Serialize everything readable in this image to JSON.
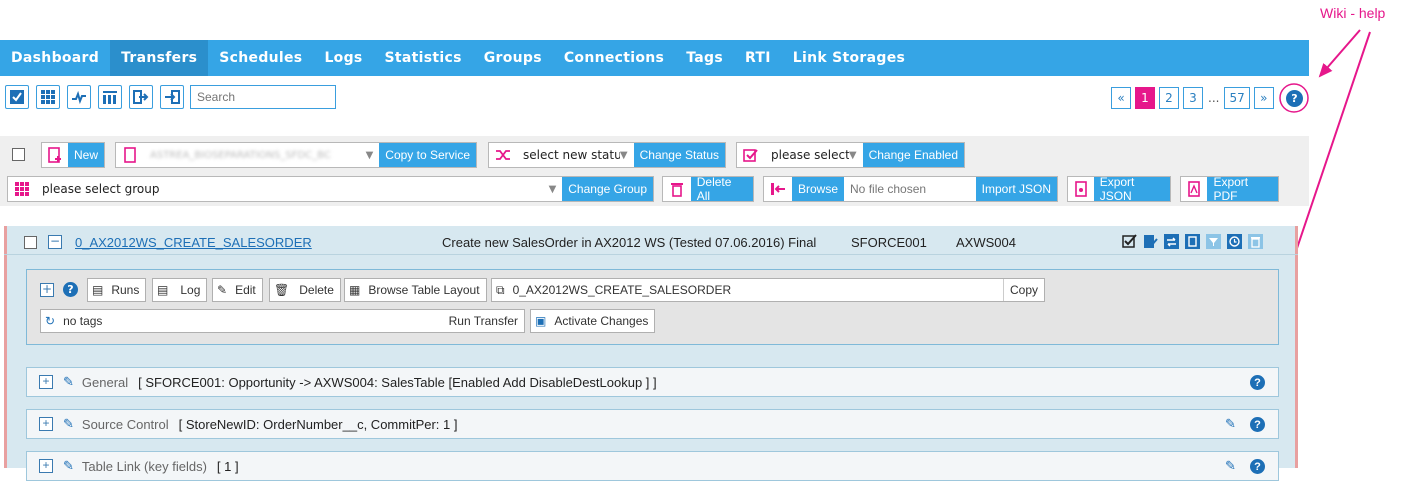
{
  "annotation": {
    "label": "Wiki - help"
  },
  "nav": [
    "Dashboard",
    "Transfers",
    "Schedules",
    "Logs",
    "Statistics",
    "Groups",
    "Connections",
    "Tags",
    "RTI",
    "Link Storages"
  ],
  "toolbar": {
    "search_placeholder": "Search"
  },
  "pager": {
    "prev": "«",
    "pages": [
      "1",
      "2",
      "3"
    ],
    "dots": "...",
    "last": "57",
    "next": "»"
  },
  "actions": {
    "new": "New",
    "service_value": "ASTREA_BIOSEPARATIONS_SFDC_BC",
    "copy_to_service": "Copy to Service",
    "status_select": "select new status",
    "change_status": "Change Status",
    "enabled_select": "please select",
    "change_enabled": "Change Enabled",
    "group_select": "please select group",
    "change_group": "Change Group",
    "delete_all": "Delete All",
    "browse": "Browse",
    "no_file": "No file chosen",
    "import_json": "Import JSON",
    "export_json": "Export JSON",
    "export_pdf": "Export PDF"
  },
  "transfer": {
    "name": "0_AX2012WS_CREATE_SALESORDER",
    "description": "Create new SalesOrder in AX2012 WS (Tested 07.06.2016) Final",
    "source": "SFORCE001",
    "dest": "AXWS004",
    "runs": "Runs",
    "log": "Log",
    "edit": "Edit",
    "delete": "Delete",
    "browse_layout": "Browse Table Layout",
    "name_field": "0_AX2012WS_CREATE_SALESORDER",
    "copy": "Copy",
    "tags": "no tags",
    "run_transfer": "Run Transfer",
    "activate": "Activate Changes"
  },
  "sections": [
    {
      "title": "General",
      "summary": "[ SFORCE001: Opportunity -> AXWS004: SalesTable [Enabled Add DisableDestLookup ] ]"
    },
    {
      "title": "Source Control",
      "summary": "[ StoreNewID: OrderNumber__c, CommitPer: 1 ]"
    },
    {
      "title": "Table Link (key fields)",
      "summary": "[ 1 ]"
    }
  ],
  "colors": {
    "accent": "#35a5e6",
    "annotation": "#e6178b",
    "help": "#1d6fb6"
  }
}
